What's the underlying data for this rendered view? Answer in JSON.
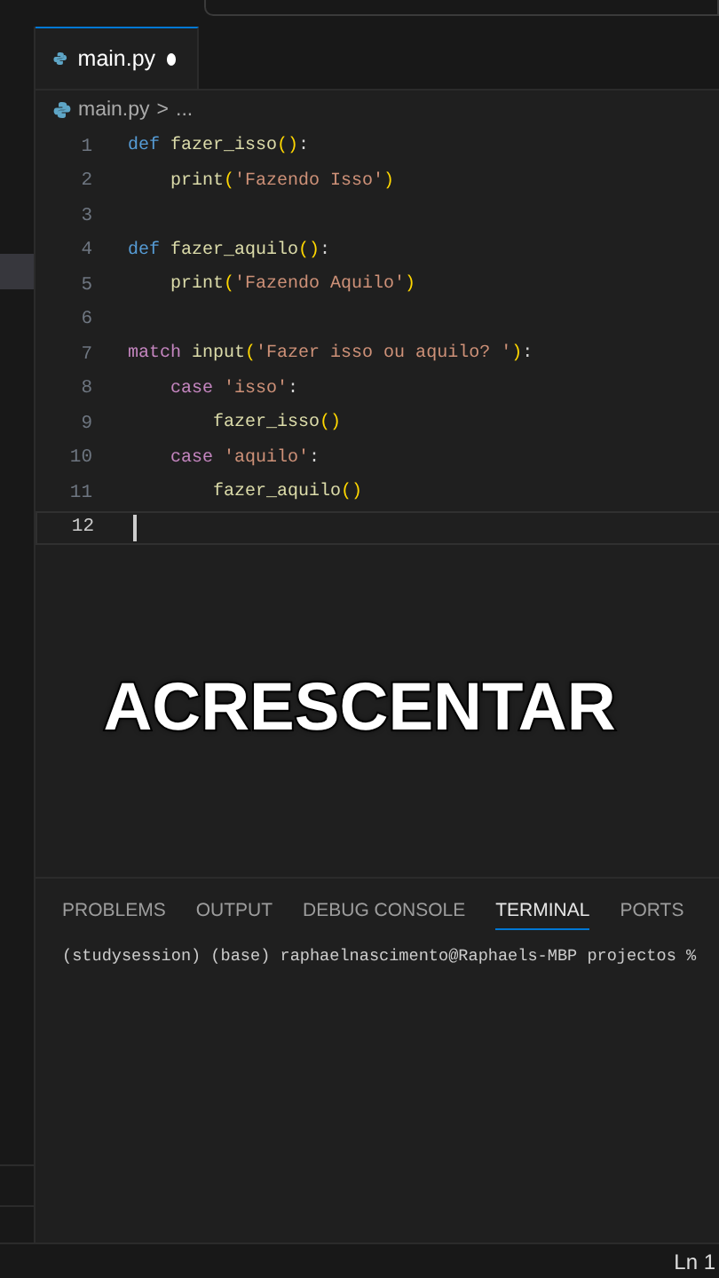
{
  "tabs": [
    {
      "label": "main.py",
      "selected": true,
      "modified": true
    }
  ],
  "breadcrumb": {
    "file": "main.py",
    "separator": ">",
    "rest": "..."
  },
  "code": {
    "lines": [
      {
        "number": "1",
        "tokens": [
          {
            "kind": "keyword",
            "text": "def "
          },
          {
            "kind": "function",
            "text": "fazer_isso"
          },
          {
            "kind": "paren",
            "text": "()"
          },
          {
            "kind": "plain",
            "text": ":"
          }
        ]
      },
      {
        "number": "2",
        "tokens": [
          {
            "kind": "function",
            "text": "    print"
          },
          {
            "kind": "paren",
            "text": "("
          },
          {
            "kind": "string",
            "text": "'Fazendo Isso'"
          },
          {
            "kind": "paren",
            "text": ")"
          }
        ]
      },
      {
        "number": "3"
      },
      {
        "number": "4",
        "tokens": [
          {
            "kind": "keyword",
            "text": "def "
          },
          {
            "kind": "function",
            "text": "fazer_aquilo"
          },
          {
            "kind": "paren",
            "text": "()"
          },
          {
            "kind": "plain",
            "text": ":"
          }
        ]
      },
      {
        "number": "5",
        "tokens": [
          {
            "kind": "function",
            "text": "    print"
          },
          {
            "kind": "paren",
            "text": "("
          },
          {
            "kind": "string",
            "text": "'Fazendo Aquilo'"
          },
          {
            "kind": "paren",
            "text": ")"
          }
        ]
      },
      {
        "number": "6"
      },
      {
        "number": "7",
        "tokens": [
          {
            "kind": "control",
            "text": "match "
          },
          {
            "kind": "function",
            "text": "input"
          },
          {
            "kind": "paren",
            "text": "("
          },
          {
            "kind": "string",
            "text": "'Fazer isso ou aquilo? '"
          },
          {
            "kind": "paren",
            "text": ")"
          },
          {
            "kind": "plain",
            "text": ":"
          }
        ]
      },
      {
        "number": "8",
        "tokens": [
          {
            "kind": "control",
            "text": "    case "
          },
          {
            "kind": "string",
            "text": "'isso'"
          },
          {
            "kind": "plain",
            "text": ":"
          }
        ]
      },
      {
        "number": "9",
        "tokens": [
          {
            "kind": "function",
            "text": "        fazer_isso"
          },
          {
            "kind": "paren",
            "text": "()"
          }
        ]
      },
      {
        "number": "10",
        "tokens": [
          {
            "kind": "control",
            "text": "    case "
          },
          {
            "kind": "string",
            "text": "'aquilo'"
          },
          {
            "kind": "plain",
            "text": ":"
          }
        ]
      },
      {
        "number": "11",
        "tokens": [
          {
            "kind": "function",
            "text": "        fazer_aquilo"
          },
          {
            "kind": "paren",
            "text": "()"
          }
        ]
      },
      {
        "number": "12",
        "current": true
      }
    ]
  },
  "caption": "ACRESCENTAR",
  "panel": {
    "tabs": [
      {
        "label": "PROBLEMS",
        "selected": false
      },
      {
        "label": "OUTPUT",
        "selected": false
      },
      {
        "label": "DEBUG CONSOLE",
        "selected": false
      },
      {
        "label": "TERMINAL",
        "selected": true
      },
      {
        "label": "PORTS",
        "selected": false
      }
    ],
    "terminal_line": "(studysession) (base) raphaelnascimento@Raphaels-MBP projectos %"
  },
  "status_bar": {
    "position": "Ln 1"
  }
}
